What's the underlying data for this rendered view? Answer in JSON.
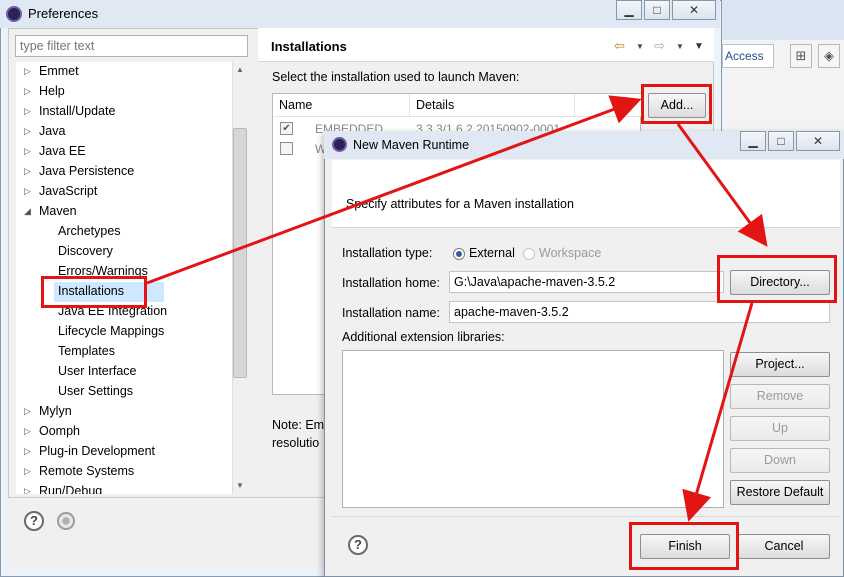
{
  "preferences": {
    "title": "Preferences",
    "filter_placeholder": "type filter text",
    "tree": [
      {
        "label": "Emmet",
        "expanded": false
      },
      {
        "label": "Help",
        "expanded": false
      },
      {
        "label": "Install/Update",
        "expanded": false
      },
      {
        "label": "Java",
        "expanded": false
      },
      {
        "label": "Java EE",
        "expanded": false
      },
      {
        "label": "Java Persistence",
        "expanded": false
      },
      {
        "label": "JavaScript",
        "expanded": false
      },
      {
        "label": "Maven",
        "expanded": true
      },
      {
        "label": "Archetypes",
        "child": true
      },
      {
        "label": "Discovery",
        "child": true
      },
      {
        "label": "Errors/Warnings",
        "child": true
      },
      {
        "label": "Installations",
        "child": true,
        "selected": true
      },
      {
        "label": "Java EE Integration",
        "child": true
      },
      {
        "label": "Lifecycle Mappings",
        "child": true
      },
      {
        "label": "Templates",
        "child": true
      },
      {
        "label": "User Interface",
        "child": true
      },
      {
        "label": "User Settings",
        "child": true
      },
      {
        "label": "Mylyn",
        "expanded": false
      },
      {
        "label": "Oomph",
        "expanded": false
      },
      {
        "label": "Plug-in Development",
        "expanded": false
      },
      {
        "label": "Remote Systems",
        "expanded": false
      },
      {
        "label": "Run/Debug",
        "expanded": false
      }
    ],
    "page": {
      "title": "Installations",
      "select_label": "Select the installation used to launch Maven:",
      "columns": [
        "Name",
        "Details"
      ],
      "rows": [
        {
          "checked": true,
          "name": "EMBEDDED",
          "details": "3.3.3/1.6.2.20150902-0001"
        },
        {
          "checked": false,
          "name": "W",
          "details": ""
        }
      ],
      "add_button": "Add...",
      "note_line1": "Note: Em",
      "note_line2": "resolutio"
    },
    "help_icon_text": "?"
  },
  "dialog": {
    "title": "New Maven Runtime",
    "description": "Specify attributes for a Maven installation",
    "installation_type_label": "Installation type:",
    "type_external": "External",
    "type_workspace": "Workspace",
    "installation_home_label": "Installation home:",
    "installation_home_value": "G:\\Java\\apache-maven-3.5.2",
    "installation_name_label": "Installation name:",
    "installation_name_value": "apache-maven-3.5.2",
    "ext_libraries_label": "Additional extension libraries:",
    "buttons": {
      "directory": "Directory...",
      "project": "Project...",
      "remove": "Remove",
      "up": "Up",
      "down": "Down",
      "restore_default": "Restore Default",
      "finish": "Finish",
      "cancel": "Cancel"
    },
    "help_icon_text": "?"
  },
  "background_ide": {
    "quick_access": "Access"
  },
  "colors": {
    "annotation_red": "#e31414",
    "selection_blue": "#cde8ff"
  }
}
